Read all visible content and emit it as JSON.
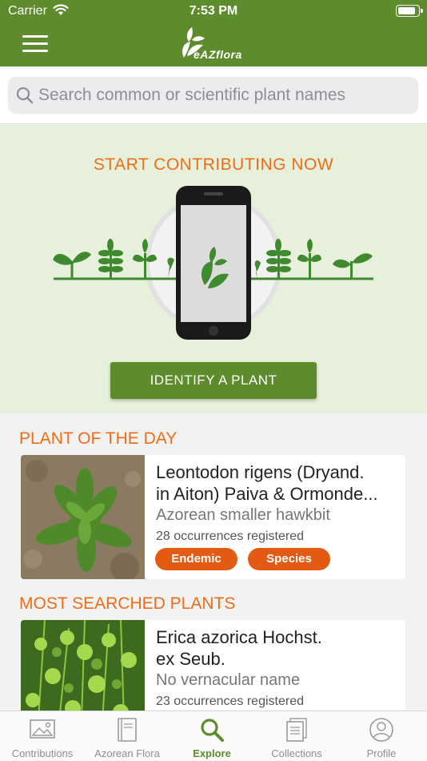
{
  "status_bar": {
    "carrier": "Carrier",
    "time": "7:53 PM",
    "battery_level": 0.9
  },
  "header": {
    "logo_text": "eAZflora"
  },
  "search": {
    "placeholder": "Search common or scientific plant names"
  },
  "hero": {
    "title": "START CONTRIBUTING NOW",
    "button_label": "IDENTIFY A PLANT"
  },
  "plant_of_day": {
    "section_title": "PLANT OF THE DAY",
    "name_line1": "Leontodon rigens (Dryand.",
    "name_line2": "in Aiton) Paiva & Ormonde...",
    "vernacular": "Azorean smaller hawkbit",
    "occurrences": "28 occurrences registered",
    "tags": [
      "Endemic",
      "Species"
    ]
  },
  "most_searched": {
    "section_title": "MOST SEARCHED PLANTS",
    "name_line1": "Erica azorica Hochst.",
    "name_line2": "ex Seub.",
    "vernacular": "No vernacular name",
    "occurrences": "23 occurrences registered"
  },
  "tabs": [
    {
      "label": "Contributions",
      "icon": "image-icon"
    },
    {
      "label": "Azorean Flora",
      "icon": "book-icon"
    },
    {
      "label": "Explore",
      "icon": "search-icon",
      "active": true
    },
    {
      "label": "Collections",
      "icon": "collections-icon"
    },
    {
      "label": "Profile",
      "icon": "profile-icon"
    }
  ],
  "colors": {
    "brand_green": "#5e8b2b",
    "accent_orange": "#ef6d17",
    "tag_orange": "#e35a13",
    "hero_bg": "#e7f0db"
  }
}
